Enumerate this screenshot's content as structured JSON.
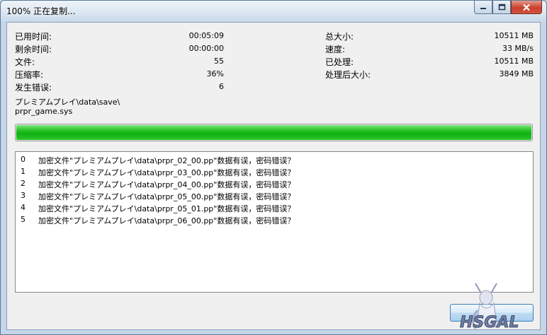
{
  "window": {
    "title": "100% 正在复制..."
  },
  "stats_left": [
    {
      "label": "已用时间:",
      "value": "00:05:09"
    },
    {
      "label": "剩余时间:",
      "value": "00:00:00"
    },
    {
      "label": "文件:",
      "value": "55"
    },
    {
      "label": "压缩率:",
      "value": "36%"
    },
    {
      "label": "发生错误:",
      "value": "6"
    }
  ],
  "stats_right": [
    {
      "label": "总大小:",
      "value": "10511 MB"
    },
    {
      "label": "速度:",
      "value": "33 MB/s"
    },
    {
      "label": "已处理:",
      "value": "10511 MB"
    },
    {
      "label": "处理后大小:",
      "value": "3849 MB"
    }
  ],
  "current_path": {
    "folder": "プレミアムプレイ\\data\\save\\",
    "file": "prpr_game.sys"
  },
  "progress": {
    "percent": 100,
    "color": "#17b817"
  },
  "errors": [
    {
      "index": "0",
      "message": "加密文件\"プレミアムプレイ\\data\\prpr_02_00.pp\"数据有误，密码错误？"
    },
    {
      "index": "1",
      "message": "加密文件\"プレミアムプレイ\\data\\prpr_03_00.pp\"数据有误，密码错误？"
    },
    {
      "index": "2",
      "message": "加密文件\"プレミアムプレイ\\data\\prpr_04_00.pp\"数据有误，密码错误？"
    },
    {
      "index": "3",
      "message": "加密文件\"プレミアムプレイ\\data\\prpr_05_00.pp\"数据有误，密码错误？"
    },
    {
      "index": "4",
      "message": "加密文件\"プレミアムプレイ\\data\\prpr_05_01.pp\"数据有误，密码错误？"
    },
    {
      "index": "5",
      "message": "加密文件\"プレミアムプレイ\\data\\prpr_06_00.pp\"数据有误，密码错误？"
    }
  ],
  "watermark": {
    "text": "HSGAL"
  }
}
